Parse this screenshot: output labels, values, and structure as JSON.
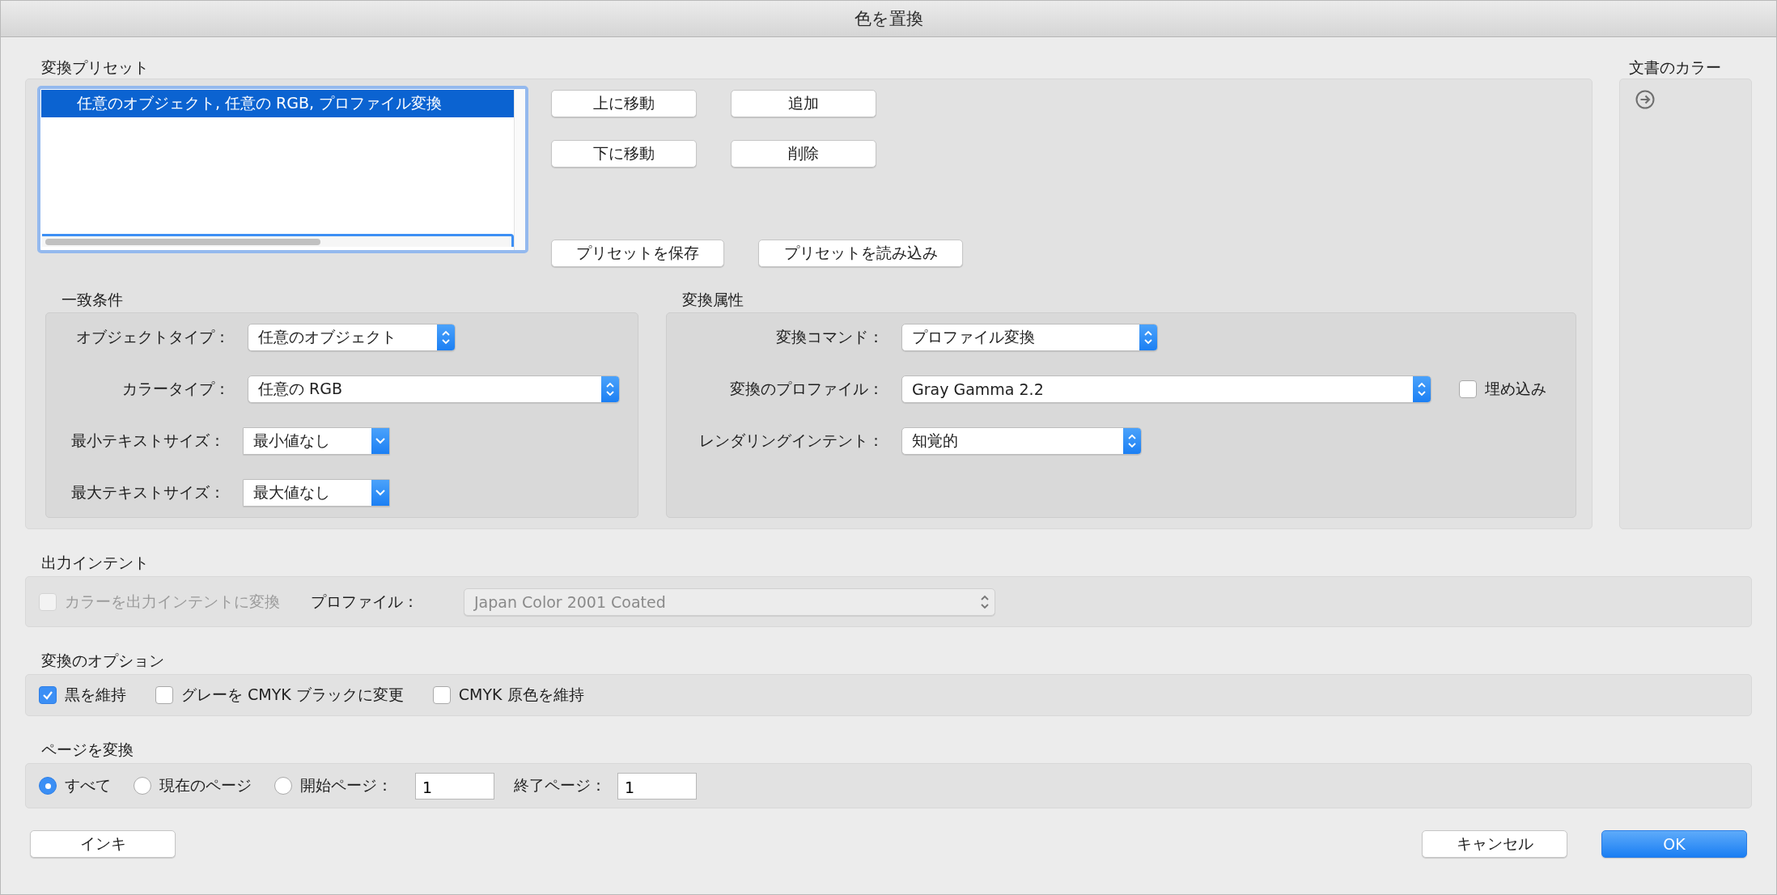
{
  "window": {
    "title": "色を置換"
  },
  "conversion_presets": {
    "label": "変換プリセット",
    "list": {
      "items": [
        {
          "text": "任意のオブジェクト, 任意の RGB, プロファイル変換",
          "selected": true
        }
      ]
    },
    "buttons": [
      {
        "label": "上に移動"
      },
      {
        "label": "追加"
      },
      {
        "label": "下に移動"
      },
      {
        "label": "削除"
      },
      {
        "label": "プリセットを保存"
      },
      {
        "label": "プリセットを読み込み"
      }
    ]
  },
  "match_criteria": {
    "label": "一致条件",
    "fields": [
      {
        "label": "オブジェクトタイプ：",
        "value": "任意のオブジェクト",
        "kind": "popup"
      },
      {
        "label": "カラータイプ：",
        "value": "任意の RGB",
        "kind": "popup"
      },
      {
        "label": "最小テキストサイズ：",
        "value": "最小値なし",
        "kind": "combo"
      },
      {
        "label": "最大テキストサイズ：",
        "value": "最大値なし",
        "kind": "combo"
      }
    ]
  },
  "conversion_attributes": {
    "label": "変換属性",
    "fields": [
      {
        "label": "変換コマンド：",
        "value": "プロファイル変換",
        "kind": "popup"
      },
      {
        "label": "変換のプロファイル：",
        "value": "Gray Gamma 2.2",
        "kind": "popup"
      },
      {
        "label": "レンダリングインテント：",
        "value": "知覚的",
        "kind": "popup"
      }
    ],
    "embed": {
      "label": "埋め込み",
      "checked": false
    }
  },
  "document_colors": {
    "label": "文書のカラー"
  },
  "output_intent": {
    "label": "出力インテント",
    "checkbox": {
      "label": "カラーを出力インテントに変換",
      "checked": false,
      "disabled": true
    },
    "profile_label": "プロファイル：",
    "profile": {
      "value": "Japan Color 2001 Coated",
      "disabled": true
    }
  },
  "conversion_options": {
    "label": "変換のオプション",
    "checkboxes": [
      {
        "label": "黒を維持",
        "checked": true
      },
      {
        "label": "グレーを CMYK ブラックに変更",
        "checked": false
      },
      {
        "label": "CMYK 原色を維持",
        "checked": false
      }
    ]
  },
  "convert_pages": {
    "label": "ページを変換",
    "options": [
      {
        "label": "すべて",
        "selected": true
      },
      {
        "label": "現在のページ",
        "selected": false
      },
      {
        "label": "開始ページ：",
        "selected": false,
        "value": "1"
      }
    ],
    "end_label": "終了ページ：",
    "end_value": "1"
  },
  "buttons": {
    "ink": "インキ",
    "cancel": "キャンセル",
    "ok": "OK"
  }
}
